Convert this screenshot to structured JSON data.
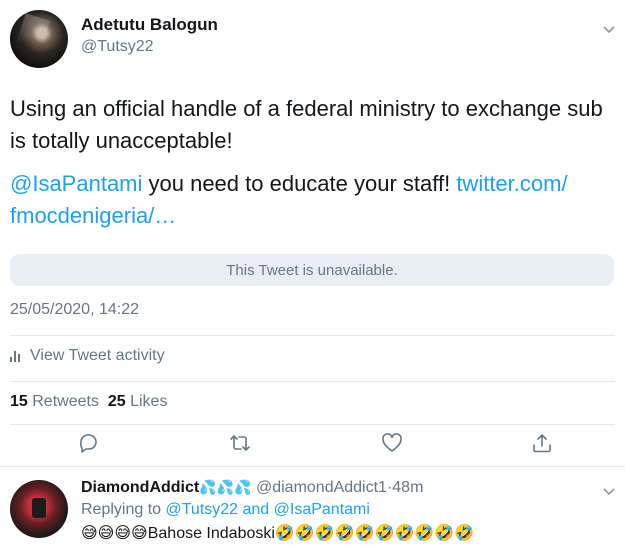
{
  "tweet": {
    "author_name": "Adetutu Balogun",
    "author_handle": "@Tutsy22",
    "text_line1": "Using an official handle of a federal ministry to exchange sub is totally unacceptable!",
    "mention": "@IsaPantami",
    "text_line2": " you need to educate your staff! ",
    "link": "twitter.com/​fmocdenigeria/…",
    "quoted_unavailable": "This Tweet is unavailable.",
    "timestamp": "25/05/2020, 14:22",
    "activity_label": "View Tweet activity",
    "retweets_count": "15",
    "retweets_label": "Retweets",
    "likes_count": "25",
    "likes_label": "Likes"
  },
  "reply": {
    "name": "DiamondAddict",
    "name_emoji": "💦💦💦",
    "handle": "@diamondAddict1",
    "separator": "·",
    "time": "48m",
    "replying_prefix": "Replying to ",
    "replying_to": "@Tutsy22 and @IsaPantami",
    "text_prefix_emoji": "😅😅😅😅",
    "text": "Bahose Indaboski",
    "text_suffix_emoji": "🤣🤣🤣🤣🤣🤣🤣🤣🤣🤣"
  },
  "icons": [
    "chevron-down-icon",
    "activity-bar-icon",
    "reply-icon",
    "retweet-icon",
    "like-icon",
    "share-icon"
  ],
  "colors": {
    "link": "#1da1f2",
    "secondary_text": "#657786",
    "primary_text": "#14171a",
    "divider": "#e1e8ed",
    "unavailable_bg": "#e9eef3"
  }
}
